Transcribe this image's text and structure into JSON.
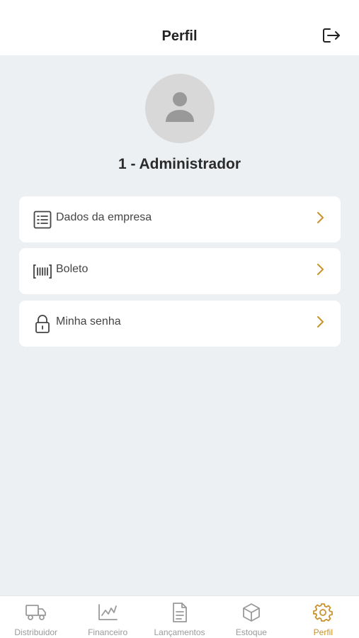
{
  "header": {
    "title": "Perfil",
    "logout_icon": "logout-icon"
  },
  "profile": {
    "avatar_icon": "user-icon",
    "name": "1 - Administrador"
  },
  "menu": {
    "items": [
      {
        "label": "Dados da empresa",
        "icon": "document-list-icon"
      },
      {
        "label": "Boleto",
        "icon": "barcode-icon"
      },
      {
        "label": "Minha senha",
        "icon": "lock-icon"
      }
    ],
    "chevron_color": "#c8922e"
  },
  "tabbar": {
    "active_color": "#c8922e",
    "inactive_color": "#9a9a9a",
    "items": [
      {
        "label": "Distribuidor",
        "icon": "truck-icon"
      },
      {
        "label": "Financeiro",
        "icon": "chart-line-icon"
      },
      {
        "label": "Lançamentos",
        "icon": "document-icon"
      },
      {
        "label": "Estoque",
        "icon": "box-icon"
      },
      {
        "label": "Perfil",
        "icon": "gear-icon",
        "active": true
      }
    ]
  }
}
